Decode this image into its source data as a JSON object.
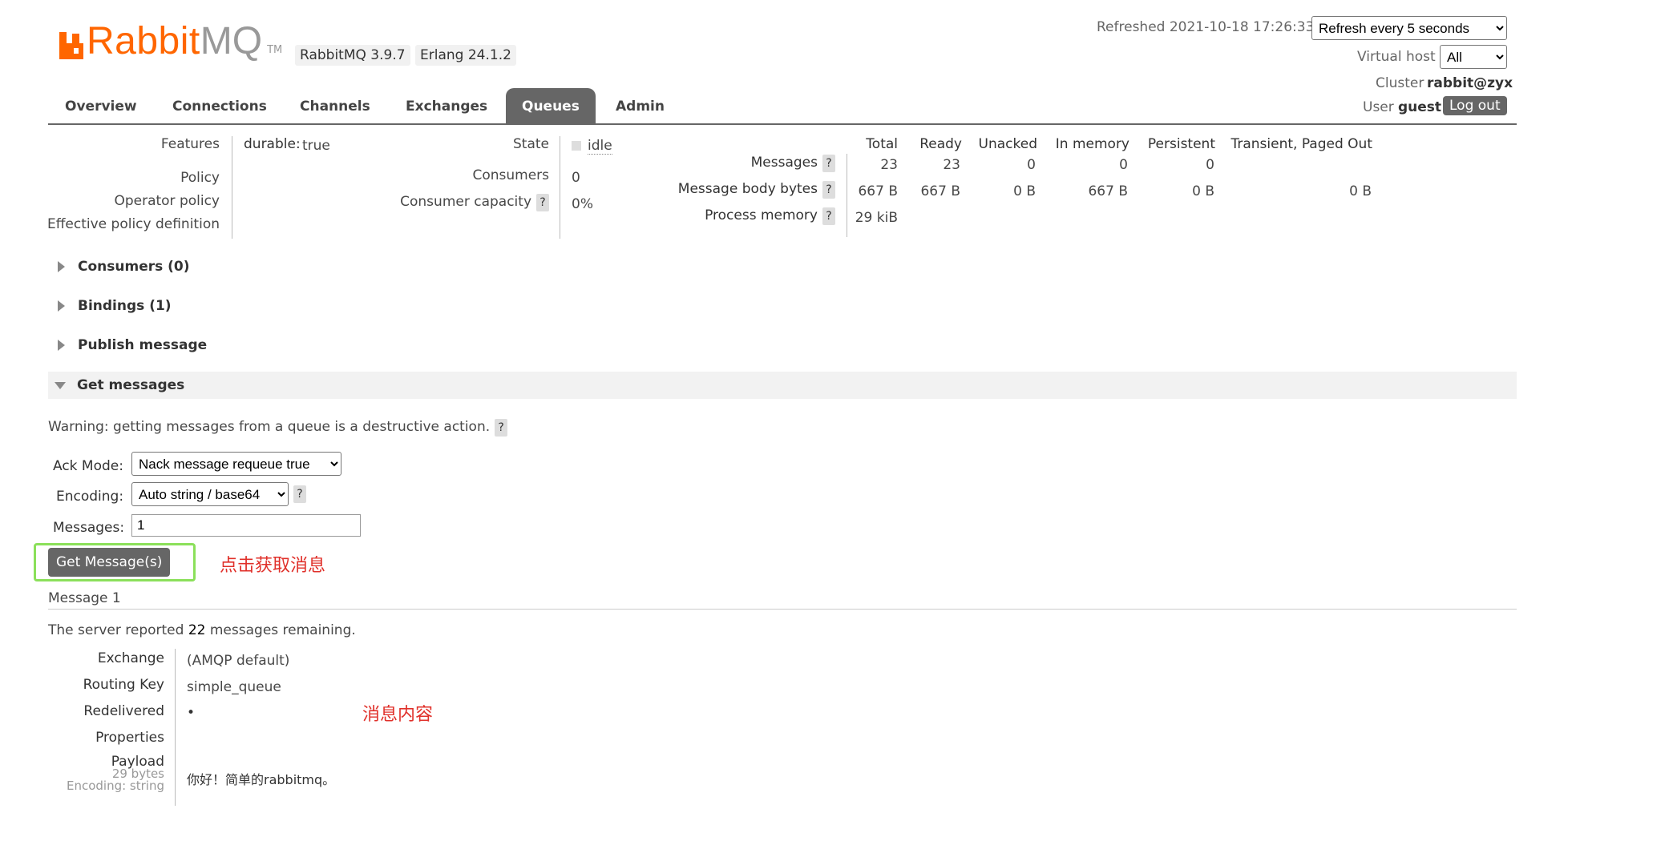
{
  "header": {
    "logo_word": "Rabbit",
    "logo_word2": "MQ",
    "logo_tm": "TM",
    "version": "RabbitMQ 3.9.7",
    "erlang": "Erlang 24.1.2",
    "refreshed": "Refreshed 2021-10-18 17:26:33",
    "refresh_select": "Refresh every 5 seconds",
    "virtual_host_label": "Virtual host",
    "virtual_host_value": "All",
    "cluster_label": "Cluster",
    "cluster_value": "rabbit@zyx",
    "user_label": "User",
    "user_value": "guest",
    "logout_label": "Log out"
  },
  "nav": {
    "tabs": [
      "Overview",
      "Connections",
      "Channels",
      "Exchanges",
      "Queues",
      "Admin"
    ],
    "active": "Queues"
  },
  "details": {
    "features_label": "Features",
    "features_key": "durable:",
    "features_value": "true",
    "policy_label": "Policy",
    "operator_policy_label": "Operator policy",
    "effective_policy_label": "Effective policy definition",
    "state_label": "State",
    "state_value": "idle",
    "consumers_label": "Consumers",
    "consumers_value": "0",
    "consumer_capacity_label": "Consumer capacity",
    "consumer_capacity_value": "0%",
    "help": "?"
  },
  "stats": {
    "columns": [
      "Total",
      "Ready",
      "Unacked",
      "In memory",
      "Persistent",
      "Transient, Paged Out"
    ],
    "rows": [
      {
        "label": "Messages",
        "values": [
          "23",
          "23",
          "0",
          "0",
          "0",
          ""
        ]
      },
      {
        "label": "Message body bytes",
        "values": [
          "667 B",
          "667 B",
          "0 B",
          "667 B",
          "0 B",
          "0 B"
        ]
      },
      {
        "label": "Process memory",
        "values": [
          "29 kiB",
          "",
          "",
          "",
          "",
          ""
        ]
      }
    ]
  },
  "sections": {
    "consumers": "Consumers (0)",
    "bindings": "Bindings (1)",
    "publish": "Publish message",
    "get": "Get messages"
  },
  "get_messages": {
    "warning": "Warning: getting messages from a queue is a destructive action.",
    "ack_mode_label": "Ack Mode:",
    "ack_mode_value": "Nack message requeue true",
    "encoding_label": "Encoding:",
    "encoding_value": "Auto string / base64",
    "messages_label": "Messages:",
    "messages_value": "1",
    "button_label": "Get Message(s)",
    "annotation_click": "点击获取消息"
  },
  "message": {
    "title": "Message 1",
    "reported_prefix": "The server reported",
    "reported_count": "22",
    "reported_suffix": "messages remaining.",
    "exchange_label": "Exchange",
    "exchange_value": "(AMQP default)",
    "routing_key_label": "Routing Key",
    "routing_key_value": "simple_queue",
    "redelivered_label": "Redelivered",
    "redelivered_value": "•",
    "properties_label": "Properties",
    "payload_label": "Payload",
    "payload_bytes": "29 bytes",
    "payload_encoding": "Encoding: string",
    "payload_value": "你好！简单的rabbitmq。",
    "annotation_content": "消息内容"
  }
}
